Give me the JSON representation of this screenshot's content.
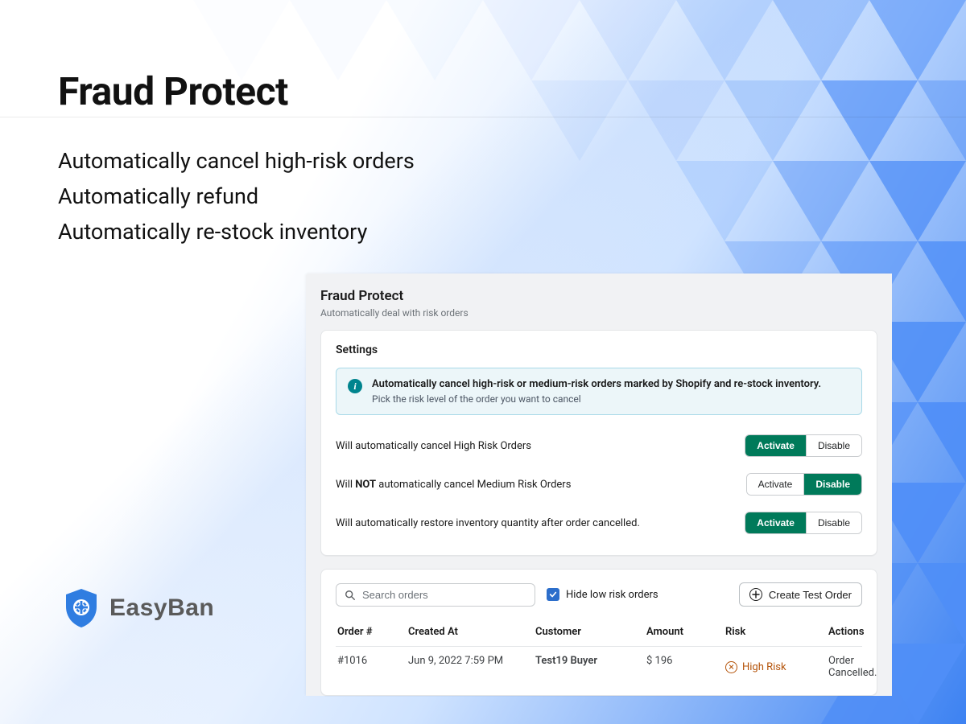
{
  "hero": {
    "title": "Fraud Protect",
    "bullets": [
      "Automatically cancel high-risk orders",
      "Automatically refund",
      "Automatically re-stock inventory"
    ]
  },
  "brand": {
    "name": "EasyBan"
  },
  "app": {
    "title": "Fraud Protect",
    "subtitle": "Automatically deal with risk orders",
    "settings": {
      "heading": "Settings",
      "info": {
        "line1": "Automatically cancel high-risk or medium-risk orders marked by Shopify and re-stock inventory.",
        "line2": "Pick the risk level of the order you want to cancel"
      },
      "rows": [
        {
          "label_pre": "Will automatically cancel ",
          "label_bold": "",
          "label_post": "High Risk Orders",
          "activate": "Activate",
          "disable": "Disable",
          "active": "activate"
        },
        {
          "label_pre": "Will ",
          "label_bold": "NOT",
          "label_post": " automatically cancel Medium Risk Orders",
          "activate": "Activate",
          "disable": "Disable",
          "active": "disable"
        },
        {
          "label_pre": "Will automatically restore inventory quantity after order cancelled.",
          "label_bold": "",
          "label_post": "",
          "activate": "Activate",
          "disable": "Disable",
          "active": "activate"
        }
      ]
    },
    "orders": {
      "search_placeholder": "Search orders",
      "hide_low_label": "Hide low risk orders",
      "hide_low_checked": true,
      "create_btn": "Create Test Order",
      "columns": {
        "order": "Order #",
        "created": "Created At",
        "customer": "Customer",
        "amount": "Amount",
        "risk": "Risk",
        "actions": "Actions"
      },
      "rows": [
        {
          "order": "#1016",
          "created": "Jun 9, 2022 7:59 PM",
          "customer": "Test19 Buyer",
          "amount": "$ 196",
          "risk": "High Risk",
          "actions": "Order Cancelled."
        }
      ]
    }
  }
}
